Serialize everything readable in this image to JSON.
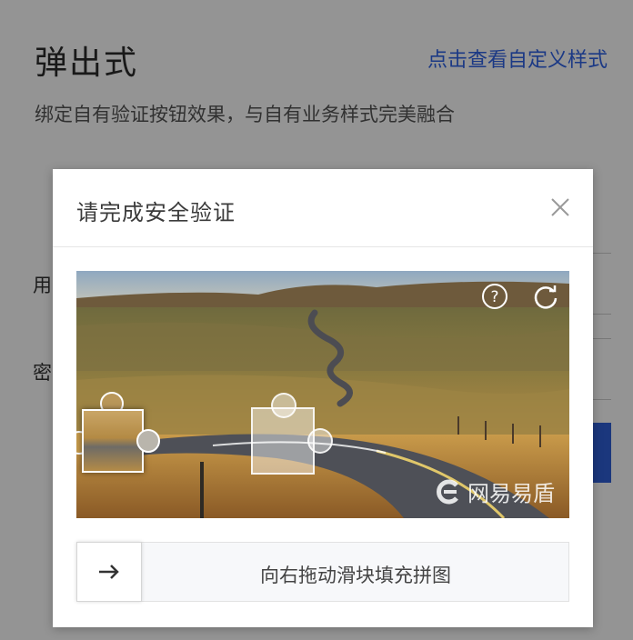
{
  "page": {
    "title": "弹出式",
    "custom_link": "点击查看自定义样式",
    "description": "绑定自有验证按钮效果，与自有业务样式完美融合",
    "user_label": "用",
    "password_label": "密"
  },
  "captcha": {
    "title": "请完成安全验证",
    "close_icon": "close-icon",
    "help_icon": "help-icon",
    "refresh_icon": "refresh-icon",
    "watermark": "网易易盾",
    "slider_text": "向右拖动滑块填充拼图",
    "slider_icon": "arrow-right-icon"
  },
  "colors": {
    "accent": "#2f62e6",
    "overlay": "rgba(0,0,0,0.42)"
  }
}
